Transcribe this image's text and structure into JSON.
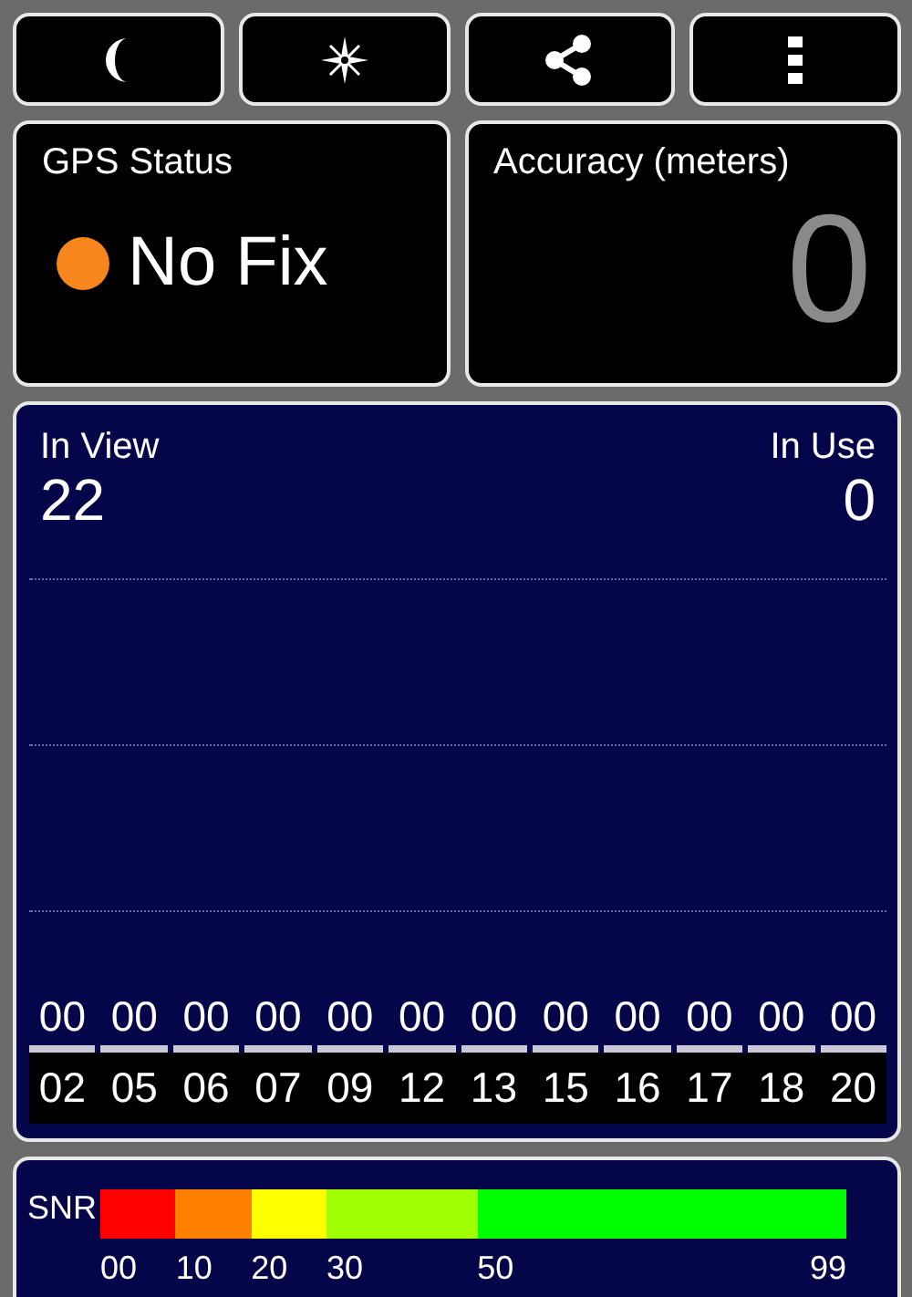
{
  "toolbar": [
    {
      "kind": "moon"
    },
    {
      "kind": "compass"
    },
    {
      "kind": "share"
    },
    {
      "kind": "more"
    }
  ],
  "gps_status": {
    "title": "GPS Status",
    "status": "No Fix",
    "color": "#f7861c"
  },
  "accuracy": {
    "title": "Accuracy (meters)",
    "value": "0"
  },
  "satellites": {
    "in_view_label": "In View",
    "in_view": "22",
    "in_use_label": "In Use",
    "in_use": "0",
    "items": [
      {
        "id": "02",
        "snr": "00"
      },
      {
        "id": "05",
        "snr": "00"
      },
      {
        "id": "06",
        "snr": "00"
      },
      {
        "id": "07",
        "snr": "00"
      },
      {
        "id": "09",
        "snr": "00"
      },
      {
        "id": "12",
        "snr": "00"
      },
      {
        "id": "13",
        "snr": "00"
      },
      {
        "id": "15",
        "snr": "00"
      },
      {
        "id": "16",
        "snr": "00"
      },
      {
        "id": "17",
        "snr": "00"
      },
      {
        "id": "18",
        "snr": "00"
      },
      {
        "id": "20",
        "snr": "00"
      }
    ]
  },
  "snr_legend": {
    "label": "SNR",
    "ticks": [
      "00",
      "10",
      "20",
      "30",
      "50",
      "99"
    ],
    "segments": [
      {
        "color": "#ff0000"
      },
      {
        "color": "#ff8000"
      },
      {
        "color": "#ffff00"
      },
      {
        "color": "#a0ff00"
      },
      {
        "color": "#00ff00"
      }
    ]
  }
}
